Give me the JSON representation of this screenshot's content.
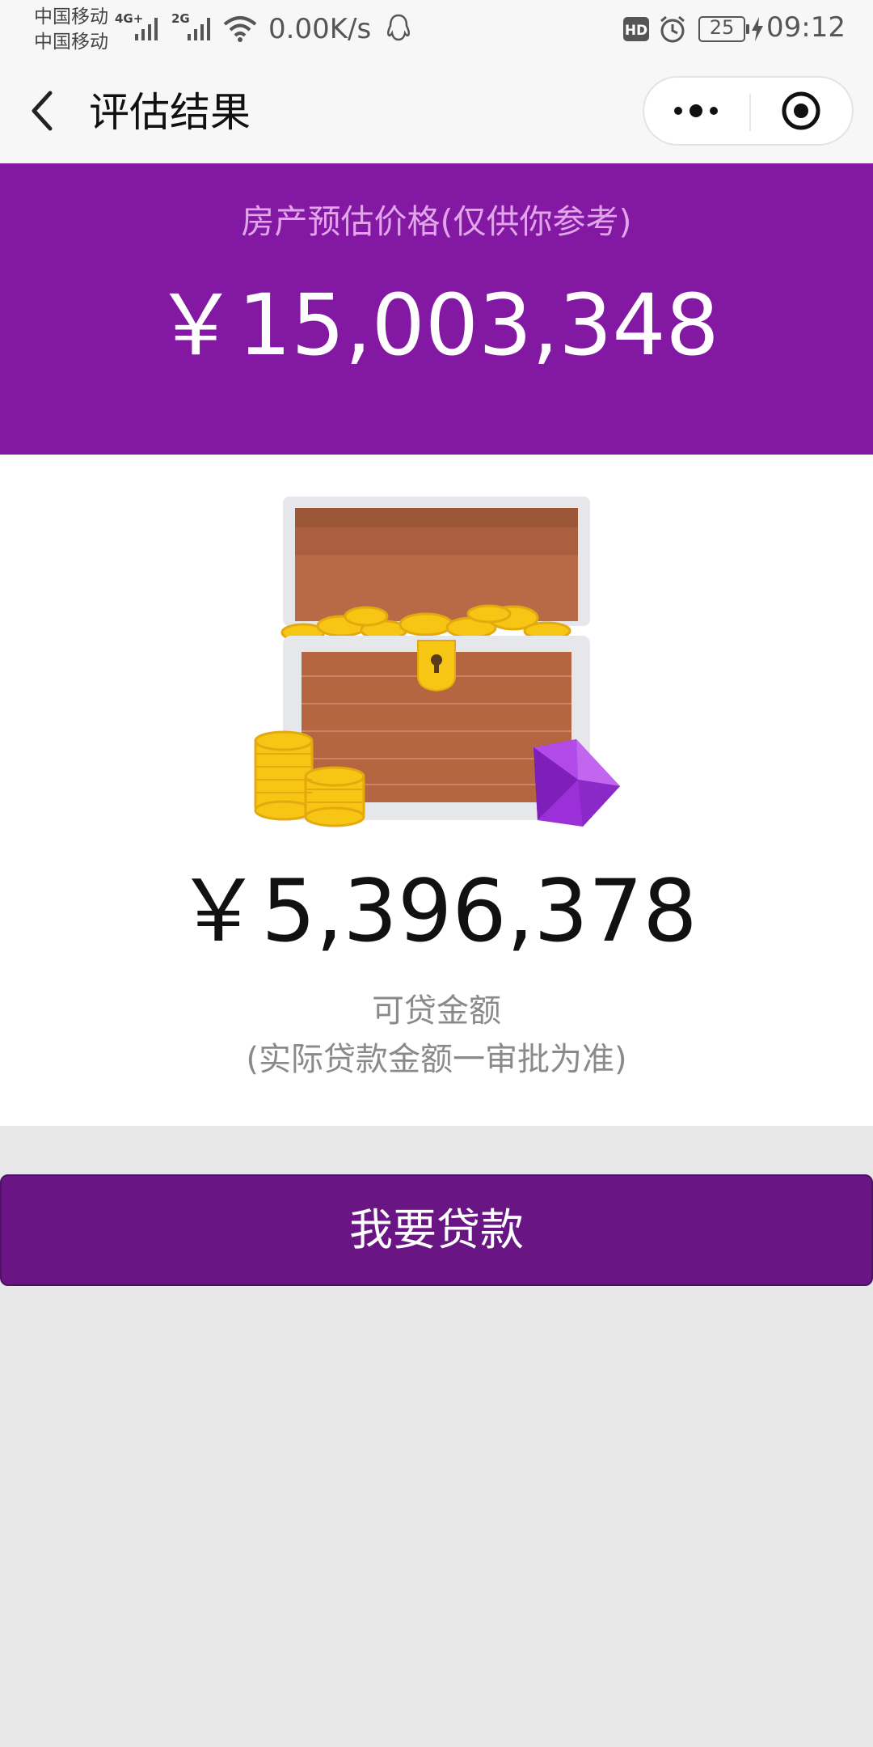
{
  "status_bar": {
    "carrier_1": "中国移动",
    "carrier_2": "中国移动",
    "signal_1_label": "4G+",
    "signal_2_label": "2G",
    "net_speed": "0.00K/s",
    "battery": "25",
    "time": "09:12",
    "icons": [
      "signal-icon",
      "wifi-icon",
      "qq-icon",
      "hd-icon",
      "alarm-icon",
      "battery-icon",
      "charging-icon"
    ]
  },
  "nav": {
    "title": "评估结果",
    "back_icon": "chevron-left-icon",
    "more_icon": "more-dots-icon",
    "close_icon": "target-icon"
  },
  "estimate": {
    "caption": "房产预估价格(仅供你参考)",
    "value": "￥15,003,348"
  },
  "loan": {
    "illustration": "treasure-chest",
    "value": "￥5,396,378",
    "label": "可贷金额",
    "note": "(实际贷款金额一审批为准)"
  },
  "action": {
    "apply_label": "我要贷款"
  },
  "colors": {
    "header_purple": "#8319a3",
    "button_purple": "#6a1584",
    "caption_pink": "#e2a5ec",
    "page_bg": "#e8e8e9"
  }
}
